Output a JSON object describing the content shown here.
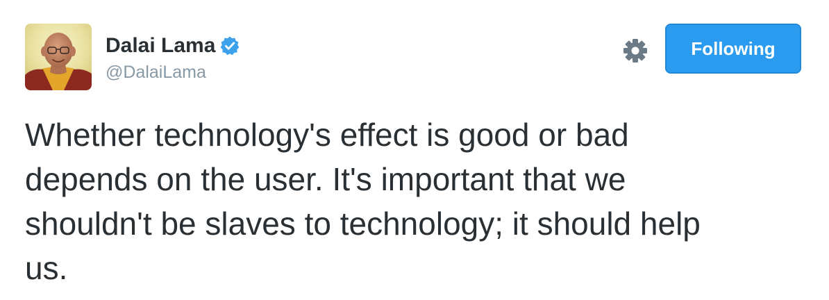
{
  "author": {
    "display_name": "Dalai Lama",
    "handle": "@DalaiLama",
    "verified": true,
    "avatar_icon": "profile-photo-monk-in-maroon-and-saffron-robes"
  },
  "actions": {
    "settings_icon": "gear-icon",
    "follow_label": "Following"
  },
  "tweet": {
    "lines": [
      "Whether technology's effect is good or bad",
      "depends on the user. It's important that we",
      "shouldn't be slaves to technology; it should help",
      "us."
    ]
  },
  "colors": {
    "accent": "#2b9bef",
    "text": "#292f33",
    "muted": "#8899a6",
    "icon": "#6b7a87",
    "verified": "#3ea1ec"
  }
}
